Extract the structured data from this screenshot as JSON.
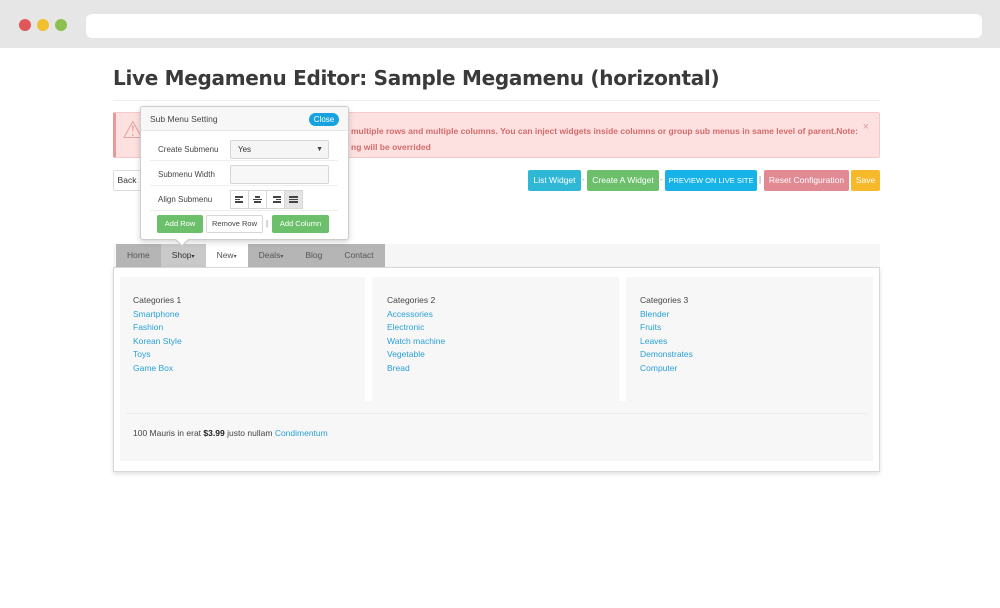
{
  "page": {
    "title": "Live Megamenu Editor: Sample Megamenu (horizontal)"
  },
  "alert": {
    "line1": "multiple rows and multiple columns. You can inject widgets inside columns or group sub menus in same level of parent.Note:",
    "line2": "ng will be overrided",
    "close": "×"
  },
  "toolbar": {
    "back": "Back",
    "list_widget": "List Widget",
    "create_widget": "Create A Widget",
    "preview": "PREVIEW ON LIVE SITE",
    "reset": "Reset Configuration",
    "save": "Save",
    "sep": "-",
    "pipe": "|"
  },
  "popover": {
    "title": "Sub Menu Setting",
    "close": "Close",
    "create_submenu_label": "Create Submenu",
    "create_submenu_value": "Yes",
    "width_label": "Submenu Width",
    "width_value": "",
    "align_label": "Align Submenu",
    "add_row": "Add Row",
    "remove_row": "Remove Row",
    "add_column": "Add Column",
    "pipe": "|"
  },
  "nav": {
    "items": [
      "Home",
      "Shop",
      "New",
      "Deals",
      "Blog",
      "Contact"
    ],
    "caret": "▾"
  },
  "mega": {
    "columns": [
      {
        "title": "Categories 1",
        "items": [
          "Smartphone",
          "Fashion",
          "Korean Style",
          "Toys",
          "Game Box"
        ]
      },
      {
        "title": "Categories 2",
        "items": [
          "Accessories",
          "Electronic",
          "Watch machine",
          "Vegetable",
          "Bread"
        ]
      },
      {
        "title": "Categories 3",
        "items": [
          "Blender",
          "Fruits",
          "Leaves",
          "Demonstrates",
          "Computer"
        ]
      }
    ],
    "bottom_prefix": "100 Mauris in erat",
    "bottom_price": "$3.99",
    "bottom_mid": "justo nullam",
    "bottom_link": "Condimentum"
  }
}
